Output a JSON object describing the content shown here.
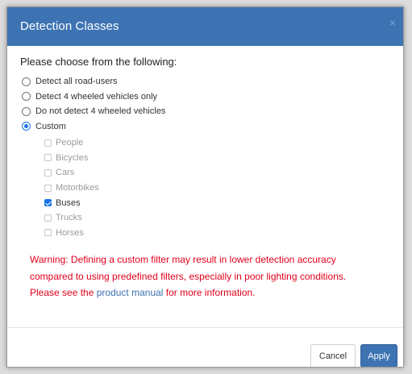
{
  "dialog": {
    "title": "Detection Classes",
    "close_glyph": "×",
    "prompt": "Please choose from the following:"
  },
  "options": [
    {
      "label": "Detect all road-users",
      "checked": false
    },
    {
      "label": "Detect 4 wheeled vehicles only",
      "checked": false
    },
    {
      "label": "Do not detect 4 wheeled vehicles",
      "checked": false
    },
    {
      "label": "Custom",
      "checked": true
    }
  ],
  "custom_classes": [
    {
      "label": "People",
      "checked": false
    },
    {
      "label": "Bicycles",
      "checked": false
    },
    {
      "label": "Cars",
      "checked": false
    },
    {
      "label": "Motorbikes",
      "checked": false
    },
    {
      "label": "Buses",
      "checked": true
    },
    {
      "label": "Trucks",
      "checked": false
    },
    {
      "label": "Horses",
      "checked": false
    }
  ],
  "warning": {
    "line1": "Warning: Defining a custom filter may result in lower detection accuracy",
    "line2": "compared to using predefined filters, especially in poor lighting conditions.",
    "line3_prefix": "Please see the ",
    "link_text": "product manual",
    "line3_suffix": " for more information."
  },
  "buttons": {
    "cancel": "Cancel",
    "apply": "Apply"
  },
  "colors": {
    "header": "#3d73b3",
    "warning": "#e0001b",
    "accent": "#1a73e8"
  }
}
